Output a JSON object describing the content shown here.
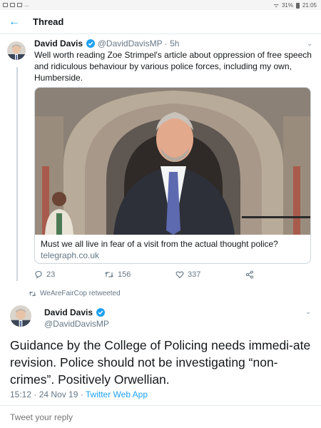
{
  "statusbar": {
    "dots": "...",
    "battery": "31%",
    "time": "21:05"
  },
  "header": {
    "title": "Thread"
  },
  "tweet1": {
    "name": "David Davis",
    "handle": "@DavidDavisMP",
    "time": "5h",
    "text": "Well worth reading Zoe Strimpel's article about oppression of free speech and ridiculous behaviour by various police forces, including my own, Humberside.",
    "card": {
      "title": "Must we all live in fear of a visit from the actual thought police?",
      "domain": "telegraph.co.uk"
    },
    "replies": "23",
    "retweets": "156",
    "likes": "337"
  },
  "retweet_context": "WeAreFairCop retweeted",
  "tweet2": {
    "name": "David Davis",
    "handle": "@DavidDavisMP",
    "text": "Guidance by the College of Policing needs immedi-ate revision. Police should not be investigating “non-crimes”.  Positively Orwellian.",
    "time": "15:12 · 24 Nov 19 ·",
    "app": "Twitter Web App"
  },
  "reply": {
    "placeholder": "Tweet your reply"
  },
  "colors": {
    "accent": "#1da1f2",
    "muted": "#657786",
    "text": "#14171a"
  }
}
